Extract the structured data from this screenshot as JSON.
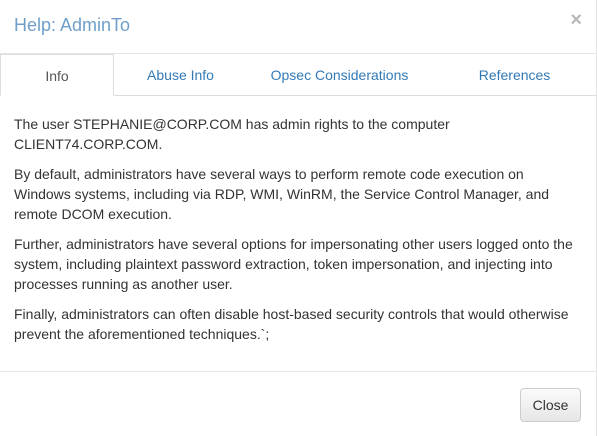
{
  "modal": {
    "title": "Help: AdminTo",
    "close_icon": "×"
  },
  "tabs": [
    {
      "label": "Info",
      "active": true
    },
    {
      "label": "Abuse Info",
      "active": false
    },
    {
      "label": "Opsec Considerations",
      "active": false
    },
    {
      "label": "References",
      "active": false
    }
  ],
  "content": {
    "paragraphs": [
      "The user STEPHANIE@CORP.COM has admin rights to the computer CLIENT74.CORP.COM.",
      "By default, administrators have several ways to perform remote code execution on Windows systems, including via RDP, WMI, WinRM, the Service Control Manager, and remote DCOM execution.",
      "Further, administrators have several options for impersonating other users logged onto the system, including plaintext password extraction, token impersonation, and injecting into processes running as another user.",
      "Finally, administrators can often disable host-based security controls that would otherwise prevent the aforementioned techniques.`;"
    ]
  },
  "footer": {
    "close_label": "Close"
  },
  "colors": {
    "title": "#6f9fc8",
    "link": "#337ab7",
    "text": "#333333"
  }
}
